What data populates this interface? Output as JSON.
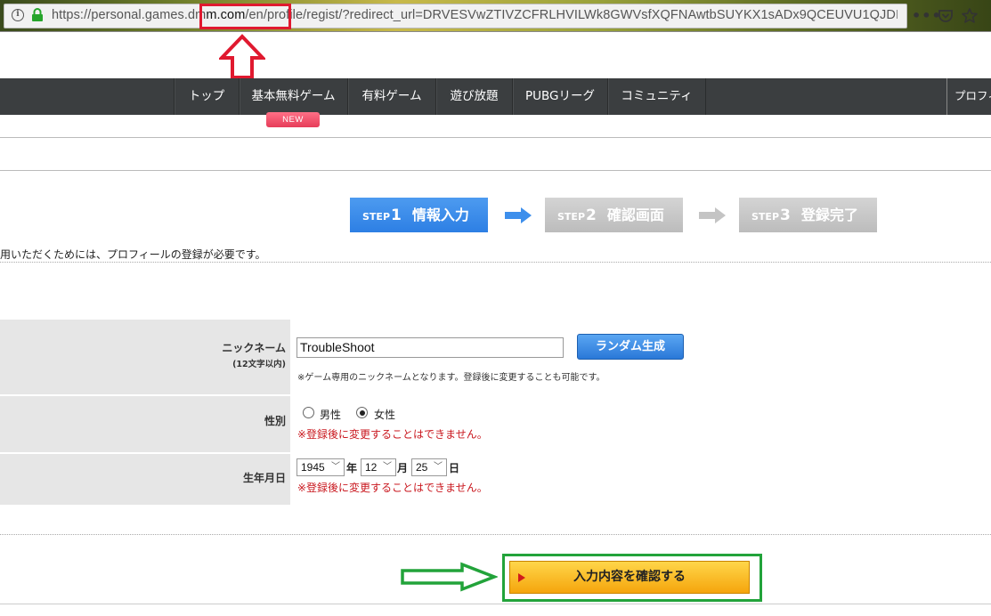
{
  "browser": {
    "url_scheme_host": "https://personal.games.dm",
    "url_domain_mid": "m.com",
    "url_path": "/en/profile/regist/?redirect_url=DRVESVwZTIVZCFRLHVILWk8GWVsfXQFNAwtbSUYKX1sADx9QCEUVU1QJDIlDRjleBVg",
    "menu_icon": "ellipsis-icon",
    "pocket_icon": "pocket-icon",
    "star_icon": "star-icon"
  },
  "nav": {
    "items": [
      "トップ",
      "基本無料ゲーム",
      "有料ゲーム",
      "遊び放題",
      "PUBGリーグ",
      "コミュニティ"
    ],
    "right": "プロフィ",
    "new_badge": "NEW"
  },
  "steps": [
    {
      "small": "STEP",
      "num": "1",
      "label": "情報入力"
    },
    {
      "small": "STEP",
      "num": "2",
      "label": "確認画面"
    },
    {
      "small": "STEP",
      "num": "3",
      "label": "登録完了"
    }
  ],
  "notice": "用いただくためには、プロフィールの登録が必要です。",
  "form": {
    "nickname_label": "ニックネーム",
    "nickname_sub": "(12文字以内)",
    "nickname_value": "TroubleShoot",
    "random_button": "ランダム生成",
    "nickname_note": "※ゲーム専用のニックネームとなります。登録後に変更することも可能です。",
    "gender_label": "性別",
    "gender_male": "男性",
    "gender_female": "女性",
    "gender_selected": "female",
    "gender_warn": "※登録後に変更することはできません。",
    "birth_label": "生年月日",
    "year": "1945",
    "year_unit": "年",
    "month": "12",
    "month_unit": "月",
    "day": "25",
    "day_unit": "日",
    "birth_warn": "※登録後に変更することはできません。"
  },
  "confirm_button": "入力内容を確認する",
  "colors": {
    "annotation_red": "#e0192f",
    "annotation_green": "#22a33a",
    "nav_bg": "#3b3e40",
    "step_active": "#2d7fe4",
    "warn": "#c9171e"
  }
}
